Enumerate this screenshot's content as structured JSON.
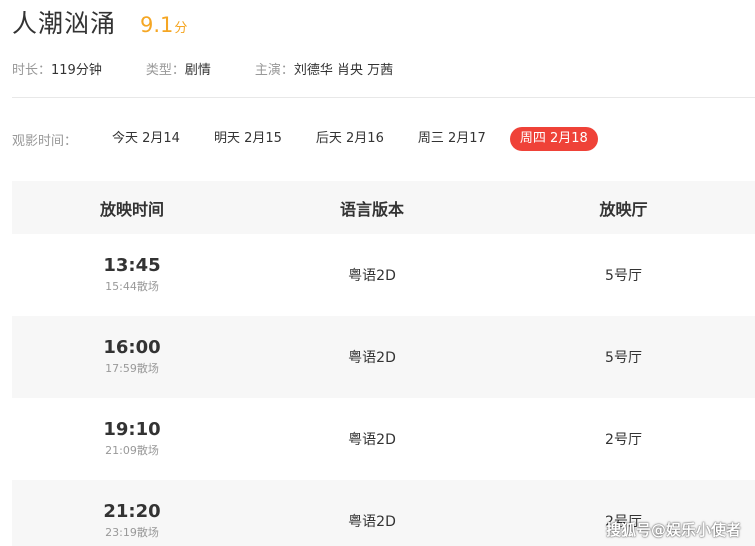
{
  "movie": {
    "title": "人潮汹涌",
    "score": "9.1",
    "score_unit": "分"
  },
  "info": {
    "duration_label": "时长：",
    "duration_value": "119分钟",
    "genre_label": "类型：",
    "genre_value": "剧情",
    "cast_label": "主演：",
    "cast_value": "刘德华 肖央 万茜"
  },
  "dates": {
    "label": "观影时间：",
    "tabs": [
      {
        "label": "今天 2月14",
        "active": false
      },
      {
        "label": "明天 2月15",
        "active": false
      },
      {
        "label": "后天 2月16",
        "active": false
      },
      {
        "label": "周三 2月17",
        "active": false
      },
      {
        "label": "周四 2月18",
        "active": true
      }
    ]
  },
  "table": {
    "headers": [
      "放映时间",
      "语言版本",
      "放映厅"
    ],
    "rows": [
      {
        "start": "13:45",
        "end": "15:44散场",
        "lang": "粤语2D",
        "hall": "5号厅"
      },
      {
        "start": "16:00",
        "end": "17:59散场",
        "lang": "粤语2D",
        "hall": "5号厅"
      },
      {
        "start": "19:10",
        "end": "21:09散场",
        "lang": "粤语2D",
        "hall": "2号厅"
      },
      {
        "start": "21:20",
        "end": "23:19散场",
        "lang": "粤语2D",
        "hall": "2号厅"
      }
    ]
  },
  "watermark": "搜狐号@娱乐小使者",
  "colors": {
    "accent": "#ef4238",
    "score": "#f5a623"
  }
}
